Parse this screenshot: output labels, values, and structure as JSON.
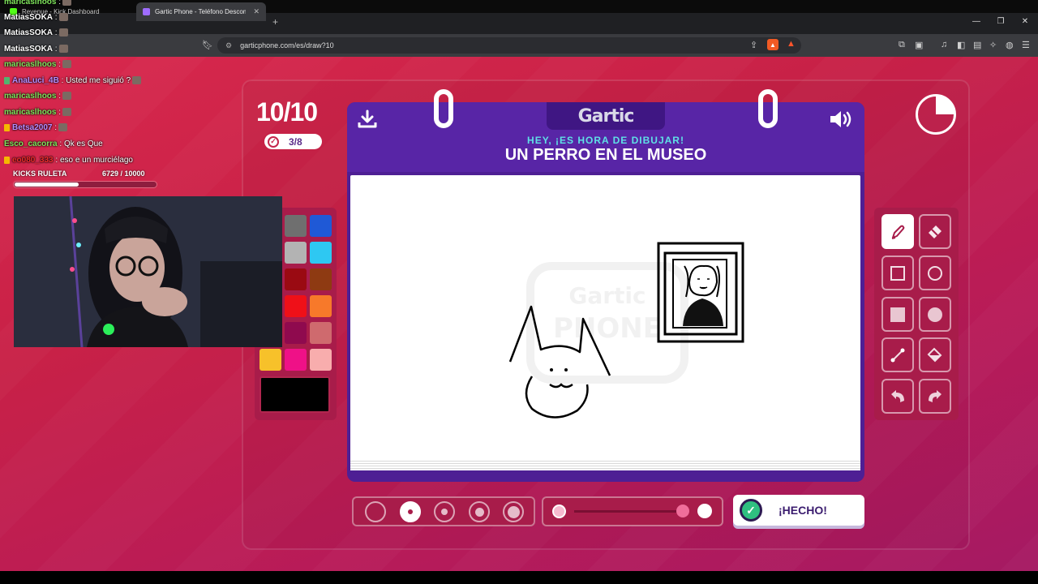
{
  "browser": {
    "tabs": [
      {
        "label": "Revenue - Kick Dashboard",
        "active": false
      },
      {
        "label": "Gartic Phone - Teléfono Descom",
        "active": true
      }
    ],
    "new_tab": "+",
    "url": "garticphone.com/es/draw?10",
    "brave_count": "5"
  },
  "game": {
    "round": "10/10",
    "players_done": "3/8",
    "logo": "Gartic",
    "subtitle": "HEY, ¡ES HORA DE DIBUJAR!",
    "prompt": "UN PERRO EN EL MUSEO",
    "done_label": "¡HECHO!",
    "timer_elapsed_fraction": 0.25
  },
  "palette": {
    "colors": [
      "#6f6f6f",
      "#1f59d6",
      "#b3b3b3",
      "#2ec8f2",
      "#9a0a12",
      "#8e3a12",
      "#ef1018",
      "#f7792a",
      "#8f0a4e",
      "#cf6a6e",
      "#f7c12a",
      "#ef1187",
      "#f8adad"
    ],
    "current": "#000000"
  },
  "tools": [
    {
      "name": "pen-tool",
      "icon": "pencil-icon",
      "selected": true
    },
    {
      "name": "eraser-tool",
      "icon": "eraser-icon",
      "selected": false
    },
    {
      "name": "rectangle-outline-tool",
      "icon": "square-outline-icon",
      "selected": false
    },
    {
      "name": "ellipse-outline-tool",
      "icon": "circle-outline-icon",
      "selected": false
    },
    {
      "name": "rectangle-fill-tool",
      "icon": "square-filled-icon",
      "selected": false
    },
    {
      "name": "ellipse-fill-tool",
      "icon": "circle-filled-icon",
      "selected": false
    },
    {
      "name": "line-tool",
      "icon": "line-icon",
      "selected": false
    },
    {
      "name": "fill-bucket-tool",
      "icon": "bucket-icon",
      "selected": false
    },
    {
      "name": "undo-tool",
      "icon": "undo-icon",
      "selected": false
    },
    {
      "name": "redo-tool",
      "icon": "redo-icon",
      "selected": false
    }
  ],
  "brush": {
    "sizes": 5,
    "selected_size_index": 1,
    "opacity_fraction": 0.97
  },
  "chat": {
    "messages": [
      {
        "user": "maricaslhoos",
        "text": " :",
        "color": "#7ee35b",
        "badge": ""
      },
      {
        "user": "MatiasSOKA",
        "text": " :",
        "color": "#ffffff",
        "badge": ""
      },
      {
        "user": "MatiasSOKA",
        "text": " :",
        "color": "#ffffff",
        "badge": ""
      },
      {
        "user": "MatiasSOKA",
        "text": " :",
        "color": "#ffffff",
        "badge": ""
      },
      {
        "user": "maricaslhoos",
        "text": " :",
        "color": "#7ee35b",
        "badge": ""
      },
      {
        "user": "AnaLuci_4B",
        "text": " : Usted me siguió ?",
        "color": "#b78cff",
        "badge": "#53b36f"
      },
      {
        "user": "maricaslhoos",
        "text": " :",
        "color": "#7ee35b",
        "badge": ""
      },
      {
        "user": "maricaslhoos",
        "text": " :",
        "color": "#7ee35b",
        "badge": ""
      },
      {
        "user": "Betsa2007",
        "text": " :",
        "color": "#b78cff",
        "badge": "#f5b700"
      },
      {
        "user": "Esco_cacorra",
        "text": " : Qk es Que",
        "color": "#7ee35b",
        "badge": ""
      },
      {
        "user": "eo080_333",
        "text": " : eso e un murciélago",
        "color": "#ef2b2b",
        "badge": "#f5b700"
      }
    ],
    "kicks_label": "KICKS RULETA",
    "kicks_value": "6729  / 10000",
    "kicks_progress": 0.6729
  }
}
